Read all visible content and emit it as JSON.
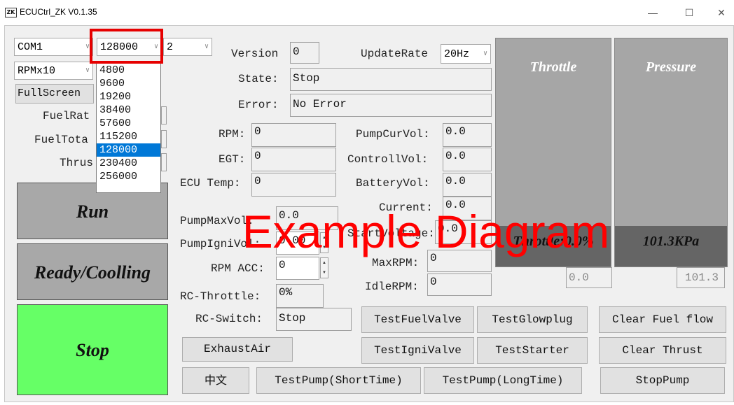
{
  "window": {
    "title": "ECUCtrl_ZK V0.1.35",
    "icon_label": "ZK",
    "minimize": "—",
    "maximize": "☐",
    "close": "✕"
  },
  "connection": {
    "port": "COM1",
    "baud": "128000",
    "third": "2",
    "unit": "RPMx10",
    "baud_options": [
      "4800",
      "9600",
      "19200",
      "38400",
      "57600",
      "115200",
      "128000",
      "230400",
      "256000"
    ],
    "baud_selected_index": 6
  },
  "left": {
    "fullscreen_label": "FullScreen",
    "fuelrate_label": "FuelRat",
    "fueltotal_label": "FuelTota",
    "thrust_label": "Thrus",
    "run_label": "Run",
    "ready_label": "Ready/Coolling",
    "stop_label": "Stop"
  },
  "status": {
    "version_label": "Version",
    "version_value": "0",
    "updaterate_label": "UpdateRate",
    "updaterate_value": "20Hz",
    "state_label": "State:",
    "state_value": "Stop",
    "error_label": "Error:",
    "error_value": "No Error"
  },
  "readings": {
    "rpm_label": "RPM:",
    "rpm_value": "0",
    "egt_label": "EGT:",
    "egt_value": "0",
    "ecutemp_label": "ECU Temp:",
    "ecutemp_value": "0",
    "pumpcurvol_label": "PumpCurVol:",
    "pumpcurvol_value": "0.0",
    "controllvol_label": "ControllVol:",
    "controllvol_value": "0.0",
    "batteryvol_label": "BatteryVol:",
    "batteryvol_value": "0.0",
    "current_label": "Current:",
    "current_value": "0.0",
    "startvoltage_label": "StartVoltage:",
    "startvoltage_value": "0.0",
    "pumpmaxvol_label": "PumpMaxVol:",
    "pumpmaxvol_value": "0.0",
    "pumpignivol_label": "PumpIgniVol:",
    "pumpignivol_value": "0.00",
    "rpmacc_label": "RPM ACC:",
    "rpmacc_value": "0",
    "maxrpm_label": "MaxRPM:",
    "maxrpm_value": "0",
    "idlerpm_label": "IdleRPM:",
    "idlerpm_value": "0",
    "rcthrottle_label": "RC-Throttle:",
    "rcthrottle_value": "0%",
    "rcswitch_label": "RC-Switch:",
    "rcswitch_value": "Stop"
  },
  "gauges": {
    "throttle_title": "Throttle",
    "throttle_text": "Throttle:0.0%",
    "throttle_readout": "0.0",
    "pressure_title": "Pressure",
    "pressure_text": "101.3KPa",
    "pressure_readout": "101.3"
  },
  "buttons": {
    "exhaust_air": "ExhaustAir",
    "chinese": "中文",
    "test_fuel_valve": "TestFuelValve",
    "test_glowplug": "TestGlowplug",
    "clear_fuel_flow": "Clear Fuel flow",
    "test_igni_valve": "TestIgniValve",
    "test_starter": "TestStarter",
    "clear_thrust": "Clear Thrust",
    "test_pump_short": "TestPump(ShortTime)",
    "test_pump_long": "TestPump(LongTime)",
    "stop_pump": "StopPump"
  },
  "watermark": "Example Diagram",
  "colors": {
    "stop_green": "#66ff66",
    "run_gray": "#a8a8a8",
    "highlight_red": "#e60000",
    "selection_blue": "#0078d7"
  }
}
